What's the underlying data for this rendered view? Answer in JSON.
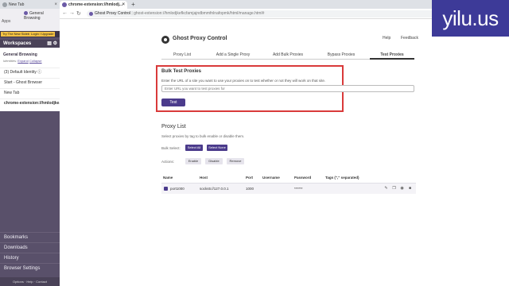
{
  "browser": {
    "tabs": [
      {
        "title": "New Tab"
      },
      {
        "title": "chrome-extension://hmlodj..."
      }
    ],
    "new_tab_symbol": "+",
    "address": {
      "host": "Ghost Proxy Control",
      "separator": "|",
      "path": "ghost-extension://hmlodjkefkcfamjajndbmmfnlnafopmk/html/manage.html#"
    }
  },
  "sidebar": {
    "general_browsing": "General Browsing",
    "apps": "Apps",
    "promo_left": "Try The New Sidebar",
    "promo_right": "Login / Upgrade",
    "workspaces": "Workspaces",
    "panel": {
      "title": "General Browsing",
      "links_prefix": "Identities:",
      "link_expand": "Expand",
      "link_collapse": "Collapse",
      "items": [
        "(3) Default Identity ⓘ",
        "Start - Ghost Browser",
        "New Tab",
        "chrome-extension://hmlodjke..."
      ]
    },
    "bottom": [
      "Bookmarks",
      "Downloads",
      "History",
      "Browser Settings"
    ],
    "footer": "Options · Help · Contact"
  },
  "watermark": "yilu.us",
  "app": {
    "title": "Ghost Proxy Control",
    "help": "Help",
    "feedback": "Feedback",
    "tabs": [
      "Proxy List",
      "Add a Single Proxy",
      "Add Bulk Proxies",
      "Bypass Proxies",
      "Test Proxies"
    ],
    "active_tab": "Test Proxies",
    "bulk_test": {
      "title": "Bulk Test Proxies",
      "description": "Enter the URL of a site you want to use your proxies on to test whether or not they will work on that site.",
      "placeholder": "Enter URL you want to test proxies for",
      "button": "Test"
    },
    "proxy_list": {
      "title": "Proxy List",
      "description": "Select proxies by tag to bulk enable or disable them.",
      "bulk_select_label": "Bulk Select:",
      "select_all": "Select All",
      "select_none": "Select None",
      "actions_label": "Actions:",
      "enable": "Enable",
      "disable": "Disable",
      "remove": "Remove",
      "columns": [
        "Name",
        "Host",
        "Port",
        "Username",
        "Password",
        "Tags (\",\" separated)"
      ],
      "rows": [
        {
          "name": "port1000",
          "host": "socks5://127.0.0.1",
          "port": "1000",
          "username": "",
          "password": "******",
          "tags": ""
        }
      ]
    }
  },
  "colors": {
    "sidebar": "#59506a",
    "accent": "#4b3b8c",
    "highlight": "#d93a3a",
    "watermark_bg": "#3d3a98"
  }
}
